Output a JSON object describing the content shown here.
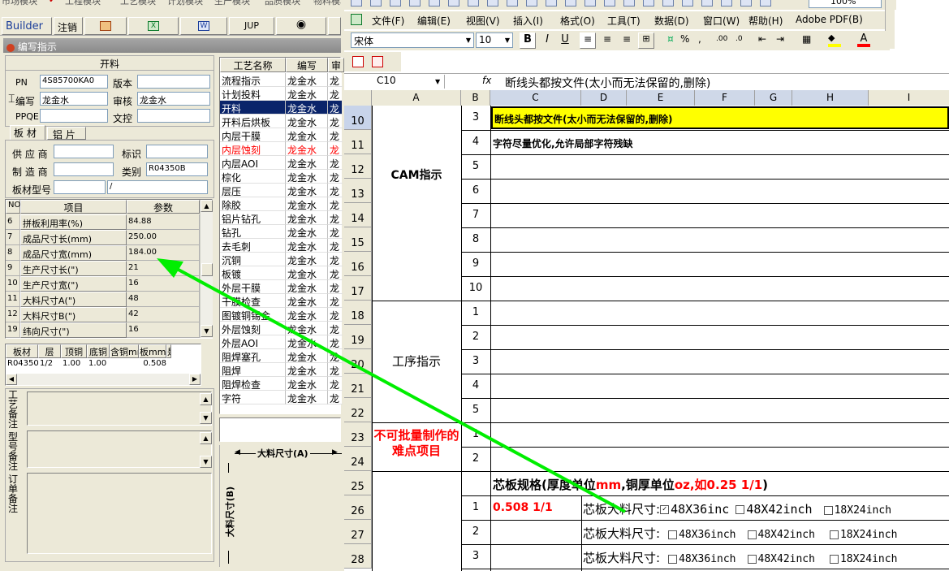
{
  "top_menu": [
    "市场模块",
    "工程模块",
    "工艺模块",
    "计划模块",
    "生产模块",
    "品质模块",
    "物料模块"
  ],
  "builder_bar": {
    "builder": "Builder",
    "logout": "注销",
    "jup": "JUP"
  },
  "panel_title": "编写指示",
  "kailiao": {
    "section_title": "开料",
    "pn_label": "PN",
    "pn_value": "4S85700KA0",
    "version_label": "版本",
    "version_value": "",
    "writer_label": "编写",
    "writer_value": "龙金水",
    "reviewer_label": "审核",
    "reviewer_value": "龙金水",
    "ppqe_label": "PPQE",
    "ppqe_value": "",
    "wenkong_label": "文控",
    "wenkong_value": ""
  },
  "material_tabs": [
    "板 材",
    "铝 片"
  ],
  "material": {
    "supplier_label": "供 应 商",
    "supplier_value": "",
    "mark_label": "标识",
    "mark_value": "",
    "maker_label": "制 造 商",
    "maker_value": "",
    "category_label": "类别",
    "category_value": "R04350B",
    "model_label": "板材型号",
    "model_value": "",
    "model_value2": "/"
  },
  "param_table": {
    "headers": [
      "NO",
      "项目",
      "参数"
    ],
    "rows": [
      {
        "no": "6",
        "item": "拼板利用率(%)",
        "val": "84.88"
      },
      {
        "no": "7",
        "item": "成品尺寸长(mm)",
        "val": "250.00"
      },
      {
        "no": "8",
        "item": "成品尺寸宽(mm)",
        "val": "184.00"
      },
      {
        "no": "9",
        "item": "生产尺寸长(\")",
        "val": "21"
      },
      {
        "no": "10",
        "item": "生产尺寸宽(\")",
        "val": "16"
      },
      {
        "no": "11",
        "item": "大料尺寸A(\")",
        "val": "48"
      },
      {
        "no": "12",
        "item": "大料尺寸B(\")",
        "val": "42"
      },
      {
        "no": "19",
        "item": "纬向尺寸(\")",
        "val": "16"
      }
    ]
  },
  "board_table": {
    "headers": [
      "板材",
      "层",
      "顶铜",
      "底铜",
      "含铜mm",
      "板mm",
      "是"
    ],
    "row": [
      "R04350B",
      "1/2",
      "1.00",
      "1.00",
      "",
      "0.508",
      ""
    ]
  },
  "notes": {
    "process": "工艺备注",
    "model": "型号备注",
    "order": "订单备注"
  },
  "process_list": {
    "headers": [
      "工艺名称",
      "编写",
      "审"
    ],
    "rows": [
      {
        "name": "流程指示",
        "writer": "龙金水",
        "rev": "龙",
        "state": "normal"
      },
      {
        "name": "计划投料",
        "writer": "龙金水",
        "rev": "龙",
        "state": "normal"
      },
      {
        "name": "开料",
        "writer": "龙金水",
        "rev": "龙",
        "state": "selected"
      },
      {
        "name": "开料后烘板",
        "writer": "龙金水",
        "rev": "龙",
        "state": "normal"
      },
      {
        "name": "内层干膜",
        "writer": "龙金水",
        "rev": "龙",
        "state": "normal"
      },
      {
        "name": "内层蚀刻",
        "writer": "龙金水",
        "rev": "龙",
        "state": "red"
      },
      {
        "name": "内层AOI",
        "writer": "龙金水",
        "rev": "龙",
        "state": "normal"
      },
      {
        "name": "棕化",
        "writer": "龙金水",
        "rev": "龙",
        "state": "normal"
      },
      {
        "name": "层压",
        "writer": "龙金水",
        "rev": "龙",
        "state": "normal"
      },
      {
        "name": "除胶",
        "writer": "龙金水",
        "rev": "龙",
        "state": "normal"
      },
      {
        "name": "铝片钻孔",
        "writer": "龙金水",
        "rev": "龙",
        "state": "normal"
      },
      {
        "name": "钻孔",
        "writer": "龙金水",
        "rev": "龙",
        "state": "normal"
      },
      {
        "name": "去毛刺",
        "writer": "龙金水",
        "rev": "龙",
        "state": "normal"
      },
      {
        "name": "沉铜",
        "writer": "龙金水",
        "rev": "龙",
        "state": "normal"
      },
      {
        "name": "板镀",
        "writer": "龙金水",
        "rev": "龙",
        "state": "normal"
      },
      {
        "name": "外层干膜",
        "writer": "龙金水",
        "rev": "龙",
        "state": "normal"
      },
      {
        "name": "干膜检查",
        "writer": "龙金水",
        "rev": "龙",
        "state": "normal"
      },
      {
        "name": "图镀铜锡金",
        "writer": "龙金水",
        "rev": "龙",
        "state": "normal"
      },
      {
        "name": "外层蚀刻",
        "writer": "龙金水",
        "rev": "龙",
        "state": "normal"
      },
      {
        "name": "外层AOI",
        "writer": "龙金水",
        "rev": "龙",
        "state": "normal"
      },
      {
        "name": "阻焊塞孔",
        "writer": "龙金水",
        "rev": "龙",
        "state": "normal"
      },
      {
        "name": "阻焊",
        "writer": "龙金水",
        "rev": "龙",
        "state": "normal"
      },
      {
        "name": "阻焊检查",
        "writer": "龙金水",
        "rev": "龙",
        "state": "normal"
      },
      {
        "name": "字符",
        "writer": "龙金水",
        "rev": "龙",
        "state": "normal"
      }
    ]
  },
  "size_diagram": {
    "a_label": "大料尺寸(A)",
    "b_label": "大料尺寸(B)"
  },
  "excel": {
    "menu": [
      "文件(F)",
      "编辑(E)",
      "视图(V)",
      "插入(I)",
      "格式(O)",
      "工具(T)",
      "数据(D)",
      "窗口(W)",
      "帮助(H)",
      "Adobe PDF(B)"
    ],
    "zoom": "100%",
    "font": "宋体",
    "font_size": "10",
    "name_box": "C10",
    "formula": "断线头都按文件(太小而无法保留的,删除)",
    "columns": [
      "A",
      "B",
      "C",
      "D",
      "E",
      "F",
      "G",
      "H",
      "I"
    ],
    "rows": [
      {
        "r": "10",
        "b": "3",
        "c": "断线头都按文件(太小而无法保留的,删除)"
      },
      {
        "r": "11",
        "b": "4",
        "c": "字符尽量优化,允许局部字符残缺"
      },
      {
        "r": "12",
        "b": "5",
        "c": ""
      },
      {
        "r": "13",
        "b": "6",
        "c": ""
      },
      {
        "r": "14",
        "b": "7",
        "c": ""
      },
      {
        "r": "15",
        "b": "8",
        "c": ""
      },
      {
        "r": "16",
        "b": "9",
        "c": ""
      },
      {
        "r": "17",
        "b": "10",
        "c": ""
      },
      {
        "r": "18",
        "b": "1",
        "c": ""
      },
      {
        "r": "19",
        "b": "2",
        "c": ""
      },
      {
        "r": "20",
        "b": "3",
        "c": ""
      },
      {
        "r": "21",
        "b": "4",
        "c": ""
      },
      {
        "r": "22",
        "b": "5",
        "c": ""
      },
      {
        "r": "23",
        "b": "1",
        "c": ""
      },
      {
        "r": "24",
        "b": "2",
        "c": ""
      },
      {
        "r": "25",
        "b": "",
        "c": ""
      },
      {
        "r": "26",
        "b": "1",
        "c": "0.508 1/1"
      },
      {
        "r": "27",
        "b": "2",
        "c": ""
      },
      {
        "r": "28",
        "b": "3",
        "c": ""
      }
    ],
    "cam_label": "CAM指示",
    "process_label": "工序指示",
    "hard_label": "不可批量制作的难点项目",
    "core_spec": {
      "prefix": "芯板规格(厚度单位",
      "unit1": "mm",
      "mid": ",铜厚单位",
      "unit2": "oz,如0.25 1/1",
      "suffix": ")"
    },
    "core_label": "芯板大料尺寸:",
    "sizes": [
      "48X36inc",
      "48X42inch",
      "18X24inch"
    ],
    "sizes_small": [
      "48X36inch",
      "48X42inch",
      "18X24inch"
    ],
    "checked_first": "✓"
  },
  "colors": {
    "highlight": "#ffff00",
    "selected": "#0a246a",
    "red": "#ff0000",
    "arrow": "#00ee00"
  }
}
